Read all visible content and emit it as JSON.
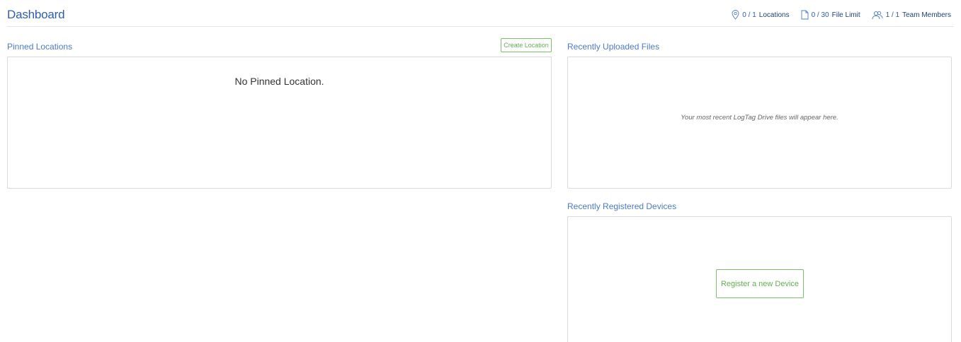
{
  "header": {
    "title": "Dashboard",
    "stats": {
      "locations": {
        "count": "0 / 1",
        "label": "Locations"
      },
      "files": {
        "count": "0 / 30",
        "label": "File Limit"
      },
      "team": {
        "count": "1 / 1",
        "label": "Team Members"
      }
    }
  },
  "pinned": {
    "title": "Pinned Locations",
    "create_button": "Create Location",
    "empty_text": "No Pinned Location."
  },
  "files": {
    "title": "Recently Uploaded Files",
    "empty_text": "Your most recent LogTag Drive files will appear here."
  },
  "devices": {
    "title": "Recently Registered Devices",
    "register_button": "Register a new Device"
  },
  "colors": {
    "brand_blue": "#2d5eae",
    "section_blue": "#4b7bc6",
    "accent_green": "#63b052"
  }
}
